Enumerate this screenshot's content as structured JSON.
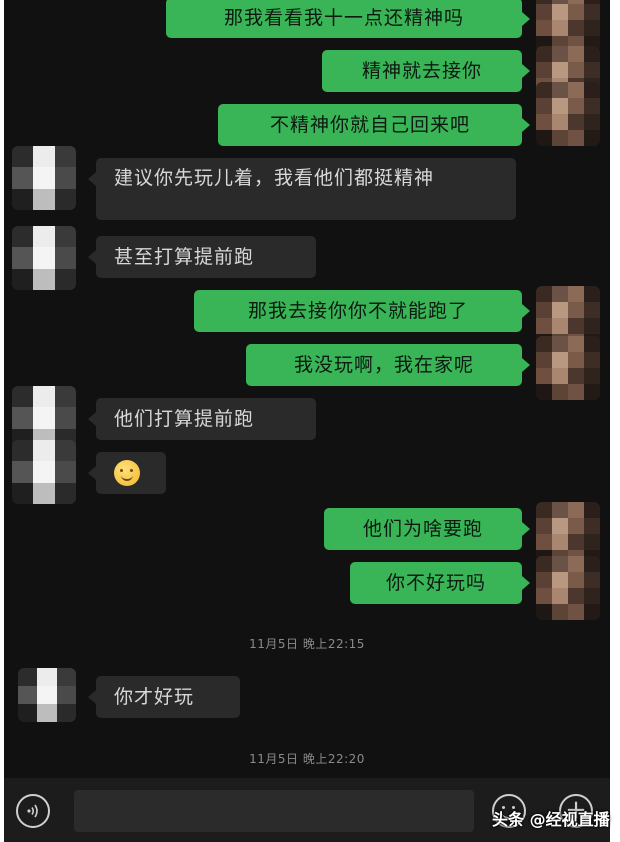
{
  "messages": [
    {
      "side": "out",
      "text": "那我看看我十一点还精神吗"
    },
    {
      "side": "out",
      "text": "精神就去接你"
    },
    {
      "side": "out",
      "text": "不精神你就自己回来吧"
    },
    {
      "side": "in",
      "text": "建议你先玩儿着，我看他们都挺精神"
    },
    {
      "side": "in",
      "text": "甚至打算提前跑"
    },
    {
      "side": "out",
      "text": "那我去接你你不就能跑了"
    },
    {
      "side": "out",
      "text": "我没玩啊，我在家呢"
    },
    {
      "side": "in",
      "text": "他们打算提前跑"
    },
    {
      "side": "in",
      "emoji": "smiley-emoji"
    },
    {
      "side": "out",
      "text": "他们为啥要跑"
    },
    {
      "side": "out",
      "text": "你不好玩吗"
    },
    {
      "side": "in",
      "text": "你才好玩"
    }
  ],
  "timestamps": [
    "11月5日 晚上22:15",
    "11月5日 晚上22:20"
  ],
  "input_bar": {
    "voice_icon": "voice-icon",
    "input_value": "",
    "emoji_icon": "emoji-icon",
    "plus_icon": "plus-icon",
    "plus_glyph": "+"
  },
  "watermark": "头条 @经视直播",
  "colors": {
    "background": "#111111",
    "outgoing_bubble": "#39b457",
    "incoming_bubble": "#2a2a2a"
  }
}
